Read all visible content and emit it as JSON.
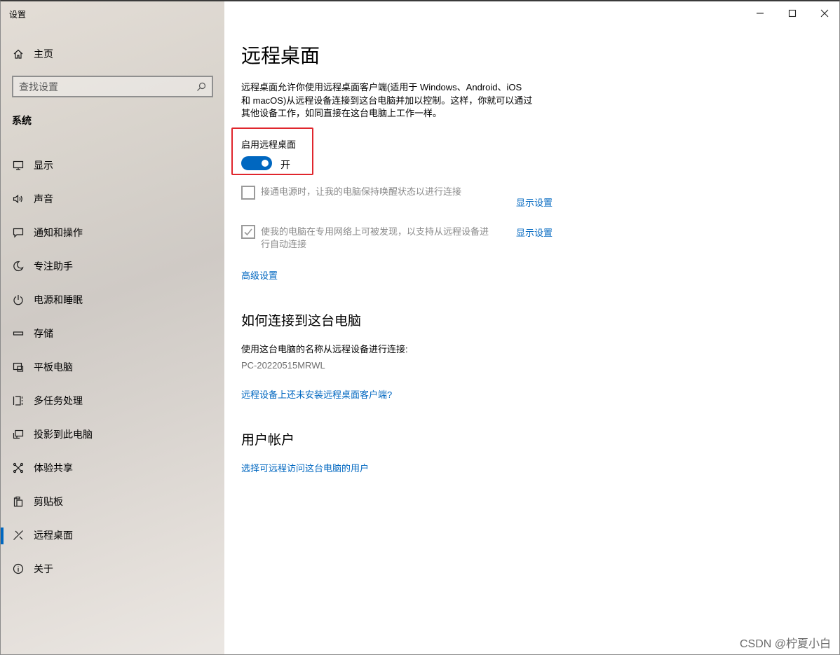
{
  "app": {
    "title": "设置"
  },
  "window_controls": {
    "minimize": "minimize-icon",
    "maximize": "maximize-icon",
    "close": "close-icon"
  },
  "sidebar": {
    "home_label": "主页",
    "search_placeholder": "查找设置",
    "section_title": "系统",
    "items": [
      {
        "label": "显示",
        "icon": "monitor-icon"
      },
      {
        "label": "声音",
        "icon": "speaker-icon"
      },
      {
        "label": "通知和操作",
        "icon": "notification-icon"
      },
      {
        "label": "专注助手",
        "icon": "moon-icon"
      },
      {
        "label": "电源和睡眠",
        "icon": "power-icon"
      },
      {
        "label": "存储",
        "icon": "storage-icon"
      },
      {
        "label": "平板电脑",
        "icon": "tablet-icon"
      },
      {
        "label": "多任务处理",
        "icon": "multitask-icon"
      },
      {
        "label": "投影到此电脑",
        "icon": "projection-icon"
      },
      {
        "label": "体验共享",
        "icon": "share-icon"
      },
      {
        "label": "剪贴板",
        "icon": "clipboard-icon"
      },
      {
        "label": "远程桌面",
        "icon": "remote-desktop-icon",
        "active": true
      },
      {
        "label": "关于",
        "icon": "info-icon"
      }
    ]
  },
  "main": {
    "title": "远程桌面",
    "description_lines": [
      "远程桌面允许你使用远程桌面客户端(适用于 Windows、Android、iOS",
      "和 macOS)从远程设备连接到这台电脑并加以控制。这样，你就可以通过",
      "其他设备工作，如同直接在这台电脑上工作一样。"
    ],
    "toggle": {
      "label": "启用远程桌面",
      "state_text": "开",
      "on": true
    },
    "options": [
      {
        "lines": [
          "接通电源时，让我的电脑保持唤醒状态以进行连接"
        ],
        "checked": false,
        "link": "显示设置"
      },
      {
        "lines": [
          "使我的电脑在专用网络上可被发现，以支持从远程设备进",
          "行自动连接"
        ],
        "checked": true,
        "link": "显示设置"
      }
    ],
    "advanced_link": "高级设置",
    "how_to": {
      "title": "如何连接到这台电脑",
      "text": "使用这台电脑的名称从远程设备进行连接:",
      "pc_name": "PC-20220515MRWL",
      "link": "远程设备上还未安装远程桌面客户端?"
    },
    "accounts": {
      "title": "用户帐户",
      "link": "选择可远程访问这台电脑的用户"
    }
  },
  "watermark": "CSDN @柠夏小白",
  "colors": {
    "accent": "#0067c0",
    "highlight_border": "#e0262d"
  }
}
